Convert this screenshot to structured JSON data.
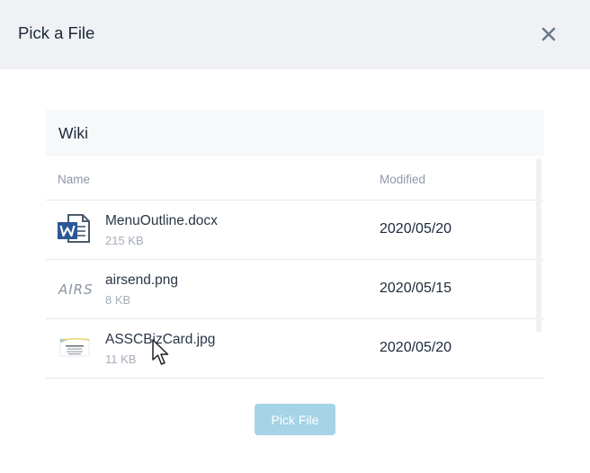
{
  "dialog": {
    "title": "Pick a File",
    "close_icon": "close-icon"
  },
  "panel": {
    "title": "Wiki",
    "columns": {
      "name": "Name",
      "modified": "Modified"
    },
    "files": [
      {
        "name": "MenuOutline.docx",
        "size": "215 KB",
        "modified": "2020/05/20",
        "icon": "word-doc-icon"
      },
      {
        "name": "airsend.png",
        "size": "8 KB",
        "modified": "2020/05/15",
        "icon": "image-thumbnail-icon",
        "thumb_text": "AIRS"
      },
      {
        "name": "ASSCBizCard.jpg",
        "size": "11 KB",
        "modified": "2020/05/20",
        "icon": "image-thumbnail-icon"
      }
    ]
  },
  "footer": {
    "pick_label": "Pick File"
  },
  "colors": {
    "header_bg": "#eff1f4",
    "button_bg": "#a5d4e6",
    "word_blue": "#2b5797"
  }
}
